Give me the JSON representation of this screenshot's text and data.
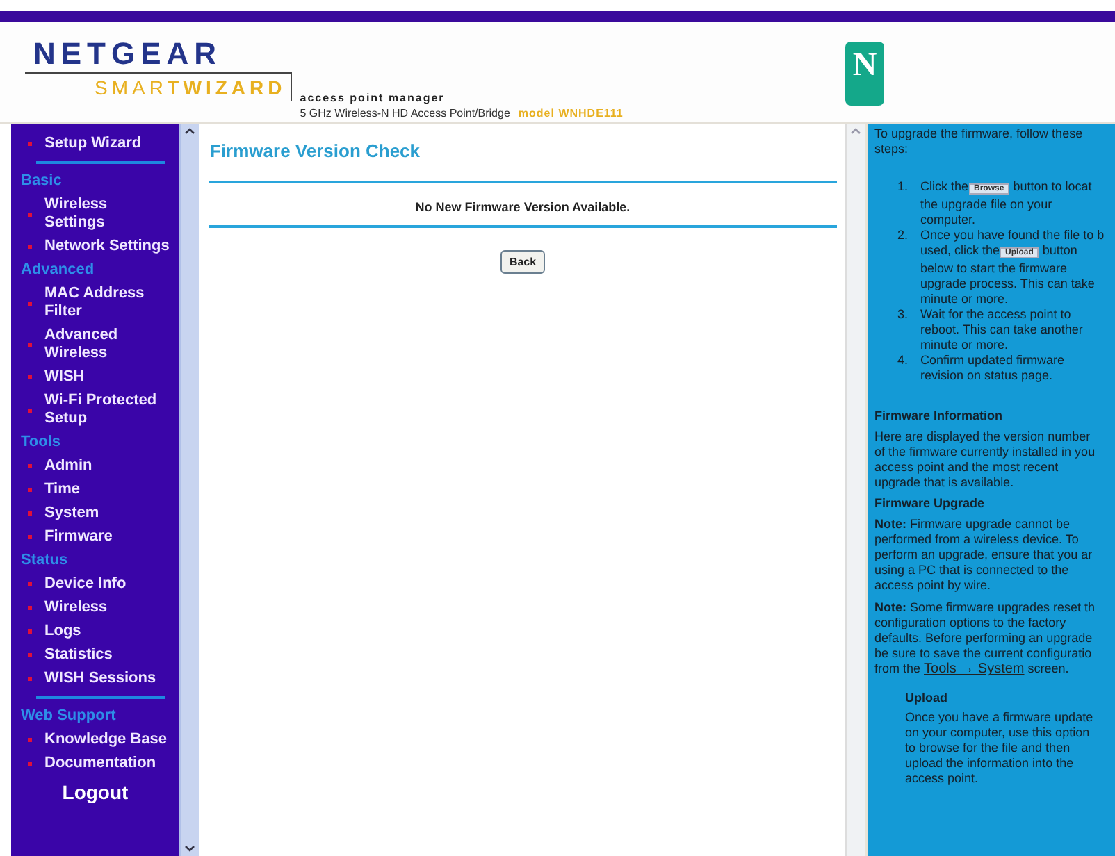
{
  "header": {
    "brand": "NETGEAR",
    "product_light": "SMART",
    "product_bold": "WIZARD",
    "subtitle": "access point manager",
    "device": "5 GHz Wireless-N HD Access Point/Bridge",
    "model": "model WNHDE111",
    "badge": "N"
  },
  "sidebar": {
    "items": [
      {
        "kind": "link",
        "label": "Setup Wizard",
        "selected": false
      },
      {
        "kind": "rule"
      },
      {
        "kind": "section",
        "label": "Basic"
      },
      {
        "kind": "link",
        "label": "Wireless\nSettings",
        "selected": false
      },
      {
        "kind": "link",
        "label": "Network Settings",
        "selected": false
      },
      {
        "kind": "section",
        "label": "Advanced"
      },
      {
        "kind": "link",
        "label": "MAC Address\nFilter",
        "selected": false
      },
      {
        "kind": "link",
        "label": "Advanced\nWireless",
        "selected": false
      },
      {
        "kind": "link",
        "label": "WISH",
        "selected": false
      },
      {
        "kind": "link",
        "label": "Wi-Fi Protected\nSetup",
        "selected": false
      },
      {
        "kind": "section",
        "label": "Tools"
      },
      {
        "kind": "link",
        "label": "Admin",
        "selected": false
      },
      {
        "kind": "link",
        "label": "Time",
        "selected": false
      },
      {
        "kind": "link",
        "label": "System",
        "selected": false
      },
      {
        "kind": "link",
        "label": "Firmware",
        "selected": false
      },
      {
        "kind": "section",
        "label": "Status"
      },
      {
        "kind": "link",
        "label": "Device Info",
        "selected": false
      },
      {
        "kind": "link",
        "label": "Wireless",
        "selected": false
      },
      {
        "kind": "link",
        "label": "Logs",
        "selected": false
      },
      {
        "kind": "link",
        "label": "Statistics",
        "selected": false
      },
      {
        "kind": "link",
        "label": "WISH Sessions",
        "selected": false
      },
      {
        "kind": "rule"
      },
      {
        "kind": "section",
        "label": "Web Support"
      },
      {
        "kind": "link",
        "label": "Knowledge Base",
        "selected": false
      },
      {
        "kind": "link",
        "label": "Documentation",
        "selected": false
      },
      {
        "kind": "logout",
        "label": "Logout"
      }
    ]
  },
  "main": {
    "title": "Firmware Version Check",
    "message": "No New Firmware Version Available.",
    "button": "Back"
  },
  "help": {
    "intro": "To upgrade the firmware, follow these\nsteps:",
    "steps": [
      {
        "number": "1.",
        "lines": [
          {
            "before": "Click the",
            "button": "Browse",
            "after": "button to locat"
          },
          {
            "before": "the upgrade file on your"
          },
          {
            "before": "computer."
          }
        ]
      },
      {
        "number": "2.",
        "lines": [
          {
            "before": "Once you have found the file to b"
          },
          {
            "before": "used, click the",
            "button": "Upload",
            "after": "button"
          },
          {
            "before": "below to start the firmware"
          },
          {
            "before": "upgrade process. This can take"
          },
          {
            "before": "minute or more."
          }
        ]
      },
      {
        "number": "3.",
        "lines": [
          {
            "before": "Wait for the access point to"
          },
          {
            "before": "reboot. This can take another"
          },
          {
            "before": "minute or more."
          }
        ]
      },
      {
        "number": "4.",
        "lines": [
          {
            "before": "Confirm updated firmware"
          },
          {
            "before": "revision on status page."
          }
        ]
      }
    ],
    "sections": [
      {
        "kind": "heading",
        "text": "Firmware Information"
      },
      {
        "kind": "para",
        "text": "Here are displayed the version number\nof the firmware currently installed in you\naccess point and the most recent\nupgrade that is available."
      },
      {
        "kind": "heading",
        "text": "Firmware Upgrade"
      },
      {
        "kind": "para",
        "text": "**Note:** Firmware upgrade cannot be\nperformed from a wireless device. To\nperform an upgrade, ensure that you ar\nusing a PC that is connected to the\naccess point by wire."
      },
      {
        "kind": "para",
        "text": "**Note:** Some firmware upgrades reset th\nconfiguration options to the factory\ndefaults. Before performing an upgrade\nbe sure to save the current configuratio",
        "link_before": "from the",
        "link": "Tools → System",
        "link_after": "screen."
      },
      {
        "kind": "subheading",
        "text": "Upload"
      },
      {
        "kind": "subpara",
        "text": "Once you have a firmware update\non your computer, use this option\nto browse for the file and then\nupload the information into the\naccess point."
      }
    ]
  }
}
